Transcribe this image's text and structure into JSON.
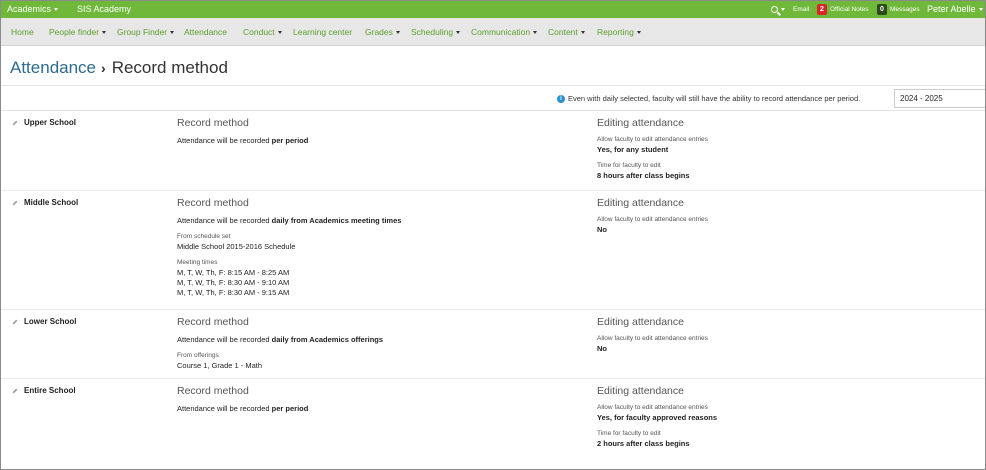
{
  "topbar": {
    "app_menu": "Academics",
    "school_name": "SIS Academy",
    "email": "Email",
    "official_notes_count": "2",
    "official_notes": "Official Notes",
    "messages_count": "0",
    "messages": "Messages",
    "user": "Peter Abelle",
    "colors": {
      "bar": "#6fb83a",
      "notes_badge": "#d6262a",
      "messages_badge": "#2d4a1d"
    }
  },
  "nav": [
    {
      "label": "Home",
      "dropdown": false
    },
    {
      "label": "People finder",
      "dropdown": true
    },
    {
      "label": "Group Finder",
      "dropdown": true
    },
    {
      "label": "Attendance",
      "dropdown": false
    },
    {
      "label": "Conduct",
      "dropdown": true
    },
    {
      "label": "Learning center",
      "dropdown": false
    },
    {
      "label": "Grades",
      "dropdown": true
    },
    {
      "label": "Scheduling",
      "dropdown": true
    },
    {
      "label": "Communication",
      "dropdown": true
    },
    {
      "label": "Content",
      "dropdown": true
    },
    {
      "label": "Reporting",
      "dropdown": true
    }
  ],
  "breadcrumb": {
    "parent": "Attendance",
    "current": "Record method"
  },
  "info": {
    "message": "Even with daily selected, faculty will still have the ability to record attendance per period.",
    "school_year": "2024 - 2025"
  },
  "sections": [
    {
      "school": "Upper School",
      "record_heading": "Record method",
      "record_prefix": "Attendance will be recorded ",
      "record_mode": "per period",
      "editing_heading": "Editing attendance",
      "allow_label": "Allow faculty to edit attendance entries",
      "allow_value": "Yes, for any student",
      "time_label": "Time for faculty to edit",
      "time_value": "8 hours after class begins"
    },
    {
      "school": "Middle School",
      "record_heading": "Record method",
      "record_prefix": "Attendance will be recorded ",
      "record_mode": "daily from Academics meeting times",
      "schedule_label": "From schedule set",
      "schedule_value": "Middle School 2015-2016 Schedule",
      "meeting_label": "Meeting times",
      "meeting_times": [
        "M, T, W, Th, F: 8:15 AM - 8:25 AM",
        "M, T, W, Th, F: 8:30 AM - 9:10 AM",
        "M, T, W, Th, F: 8:30 AM - 9:15 AM"
      ],
      "editing_heading": "Editing attendance",
      "allow_label": "Allow faculty to edit attendance entries",
      "allow_value": "No"
    },
    {
      "school": "Lower School",
      "record_heading": "Record method",
      "record_prefix": "Attendance will be recorded ",
      "record_mode": "daily from Academics offerings",
      "offerings_label": "From offerings",
      "offerings_value": "Course 1, Grade 1 - Math",
      "editing_heading": "Editing attendance",
      "allow_label": "Allow faculty to edit attendance entries",
      "allow_value": "No"
    },
    {
      "school": "Entire School",
      "record_heading": "Record method",
      "record_prefix": "Attendance will be recorded ",
      "record_mode": "per period",
      "editing_heading": "Editing attendance",
      "allow_label": "Allow faculty to edit attendance entries",
      "allow_value": "Yes, for faculty approved reasons",
      "time_label": "Time for faculty to edit",
      "time_value": "2 hours after class begins"
    }
  ]
}
